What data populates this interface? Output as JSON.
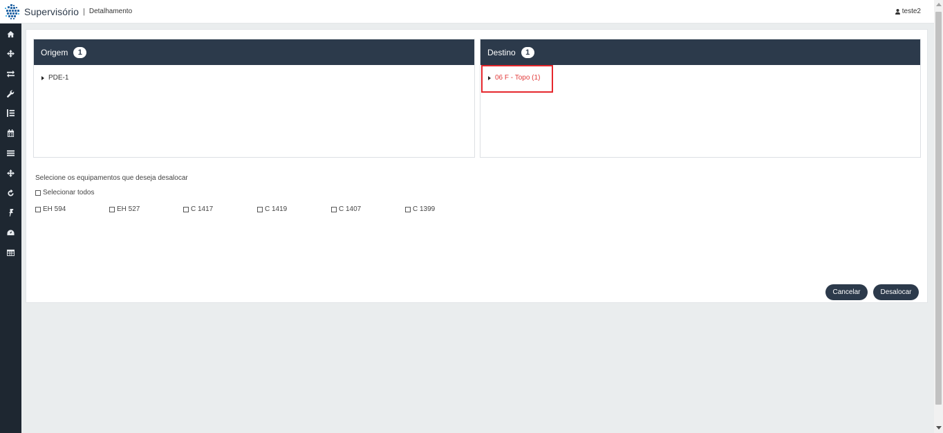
{
  "header": {
    "app_title": "Supervisório",
    "separator": "|",
    "subtitle": "Detalhamento",
    "user": "teste2"
  },
  "sidebar": {
    "items": [
      {
        "icon": "home-icon"
      },
      {
        "icon": "move-arrows-icon"
      },
      {
        "icon": "exchange-icon"
      },
      {
        "icon": "wrench-icon"
      },
      {
        "icon": "list-indent-icon"
      },
      {
        "icon": "calendar-icon"
      },
      {
        "icon": "bars-icon"
      },
      {
        "icon": "move-arrows-icon"
      },
      {
        "icon": "refresh-icon"
      },
      {
        "icon": "pin-icon"
      },
      {
        "icon": "dashboard-icon"
      },
      {
        "icon": "table-icon"
      }
    ]
  },
  "origem": {
    "title": "Origem",
    "count": "1",
    "item": "PDE-1"
  },
  "destino": {
    "title": "Destino",
    "count": "1",
    "item": "06 F - Topo (1)"
  },
  "selection": {
    "instruction": "Selecione os equipamentos que deseja desalocar",
    "select_all_label": "Selecionar todos",
    "equipment": [
      "EH 594",
      "EH 527",
      "C 1417",
      "C 1419",
      "C 1407",
      "C 1399"
    ]
  },
  "actions": {
    "cancel_label": "Cancelar",
    "dealloc_label": "Desalocar"
  },
  "colors": {
    "sidebar_bg": "#1e2731",
    "panel_header_bg": "#2c3a4b",
    "highlight": "#e5272c",
    "destino_item": "#e23b3b"
  }
}
